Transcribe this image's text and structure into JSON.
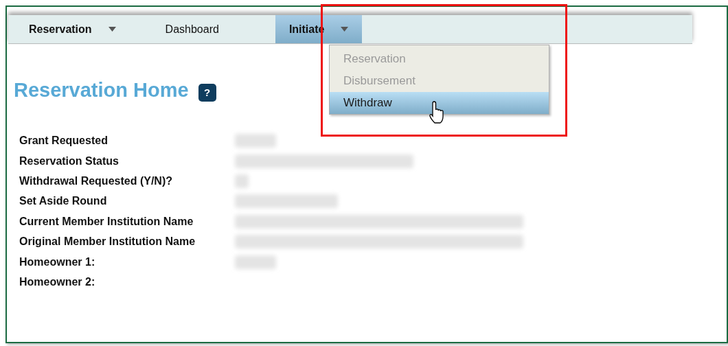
{
  "nav": [
    {
      "label": "Reservation",
      "caret": true,
      "selected": false
    },
    {
      "label": "Dashboard",
      "caret": false,
      "selected": false
    },
    {
      "label": "Initiate",
      "caret": true,
      "selected": true
    }
  ],
  "menu": [
    {
      "label": "Reservation",
      "disabled": true,
      "selected": false
    },
    {
      "label": "Disbursement",
      "disabled": true,
      "selected": false
    },
    {
      "label": "Withdraw",
      "disabled": false,
      "selected": true
    }
  ],
  "page_title": "Reservation Home",
  "help": "?",
  "fields": [
    {
      "label": "Grant Requested",
      "blurred": true
    },
    {
      "label": "Reservation Status",
      "blurred": true
    },
    {
      "label": "Withdrawal Requested (Y/N)?",
      "blurred": true
    },
    {
      "label": "Set Aside Round",
      "blurred": true
    },
    {
      "label": "Current Member Institution Name",
      "blurred": true
    },
    {
      "label": "Original Member Institution Name",
      "blurred": true
    },
    {
      "label": "Homeowner 1:",
      "blurred": true
    },
    {
      "label": "Homeowner 2:",
      "blurred": false
    }
  ]
}
